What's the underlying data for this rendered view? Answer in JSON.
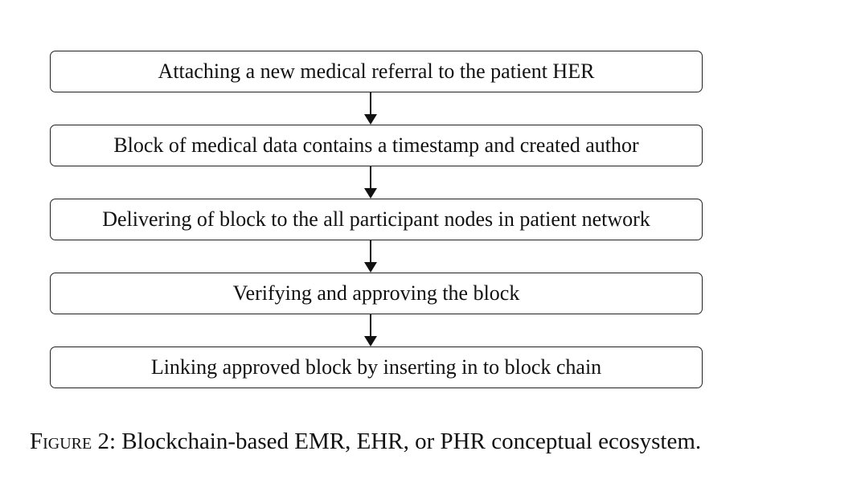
{
  "diagram": {
    "steps": [
      "Attaching a new medical referral to the patient HER",
      "Block of medical data contains a timestamp and created author",
      "Delivering of block to the all participant nodes in patient network",
      "Verifying and approving the block",
      "Linking approved block by inserting in to block chain"
    ]
  },
  "caption": {
    "label": "Figure 2:",
    "text": "Blockchain-based EMR, EHR, or PHR conceptual ecosystem."
  }
}
